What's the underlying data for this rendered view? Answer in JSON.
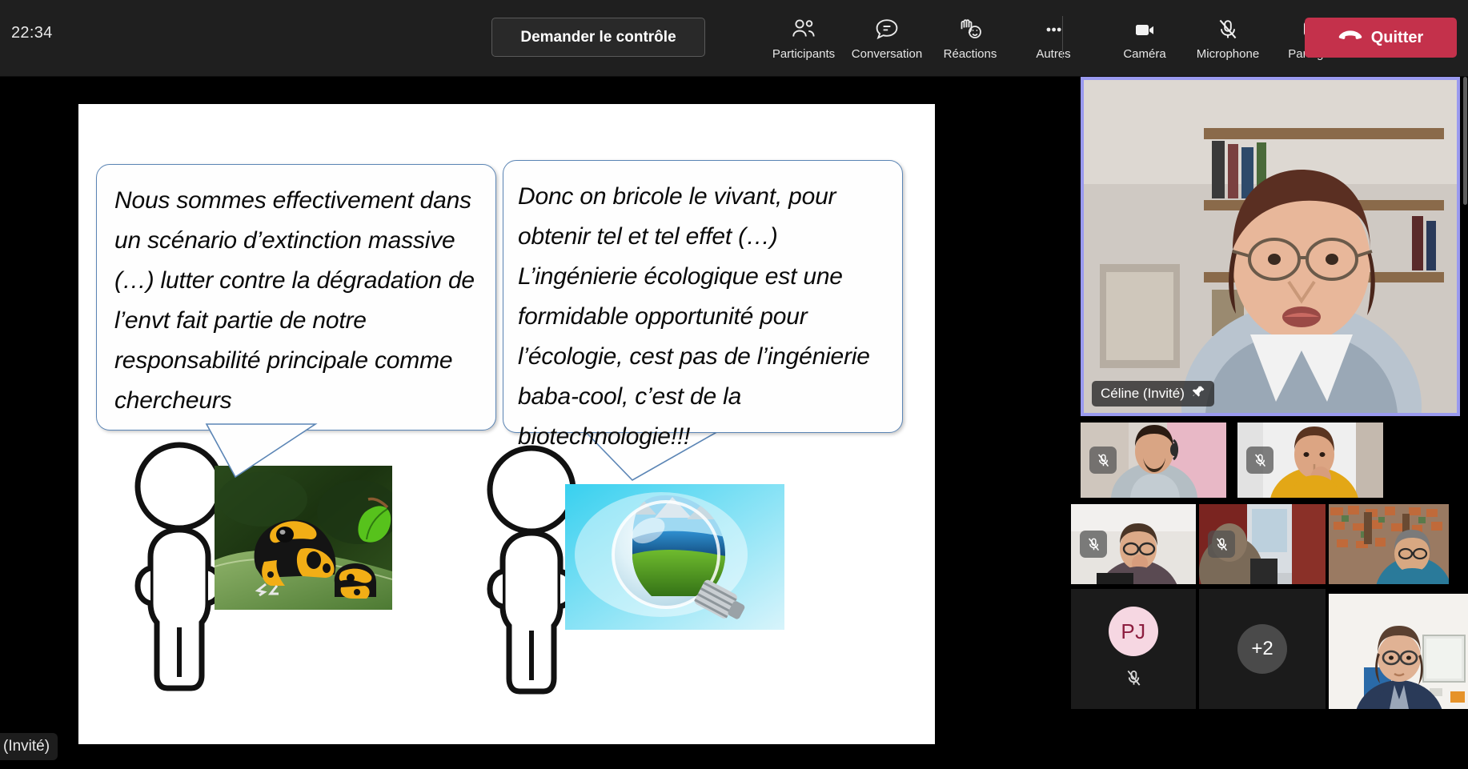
{
  "meeting": {
    "timer": "22:34",
    "request_control_label": "Demander le contrôle",
    "leave_label": "Quitter",
    "accent_red": "#c4314b",
    "active_speaker_border": "#9a9aef",
    "toolbar_bg": "#1f1f1f"
  },
  "toolbar": {
    "items": [
      {
        "label": "Participants",
        "icon": "participants-icon"
      },
      {
        "label": "Conversation",
        "icon": "chat-icon"
      },
      {
        "label": "Réactions",
        "icon": "reactions-icon"
      },
      {
        "label": "Autres",
        "icon": "more-icon"
      }
    ],
    "right_items": [
      {
        "label": "Caméra",
        "icon": "camera-icon",
        "state": "on"
      },
      {
        "label": "Microphone",
        "icon": "microphone-muted-icon",
        "state": "muted"
      },
      {
        "label": "Partager",
        "icon": "share-icon",
        "state": "off"
      }
    ]
  },
  "slide": {
    "bubble_left": "Nous sommes effectivement dans un scénario d’extinction massive (…) lutter contre la dégradation de l’envt fait partie de notre responsabilité principale comme chercheurs",
    "bubble_right": "Donc on bricole le vivant, pour obtenir tel et tel effet (…) L’ingénierie écologique est une formidable opportunité pour l’écologie, cest pas de l’ingénierie baba-cool, c’est de la biotechnologie!!!",
    "figure_left_name": "stick-figure-left",
    "figure_right_name": "stick-figure-right",
    "photo_left_alt": "Grenouille venimeuse jaune et noire sur une feuille",
    "photo_right_alt": "Ampoule contenant un paysage de nature",
    "bubble_border_color": "#5b85b5"
  },
  "rail": {
    "active_speaker": {
      "name": "Céline (Invité)",
      "pinned": true,
      "pin_icon": "pin-icon"
    },
    "participants": [
      {
        "id": "p1",
        "muted": true,
        "video": true
      },
      {
        "id": "p2",
        "muted": true,
        "video": true
      },
      {
        "id": "p3",
        "muted": true,
        "video": true
      },
      {
        "id": "p4",
        "muted": true,
        "video": true
      },
      {
        "id": "p5",
        "muted": false,
        "video": true
      },
      {
        "id": "p6",
        "muted": false,
        "video": true
      }
    ],
    "avatar": {
      "initials": "PJ",
      "muted": true,
      "bg": "#f6d7e2",
      "fg": "#8c1d3f"
    },
    "overflow": {
      "label": "+2"
    }
  },
  "overlay": {
    "cut_name_label": "(Invité)"
  }
}
